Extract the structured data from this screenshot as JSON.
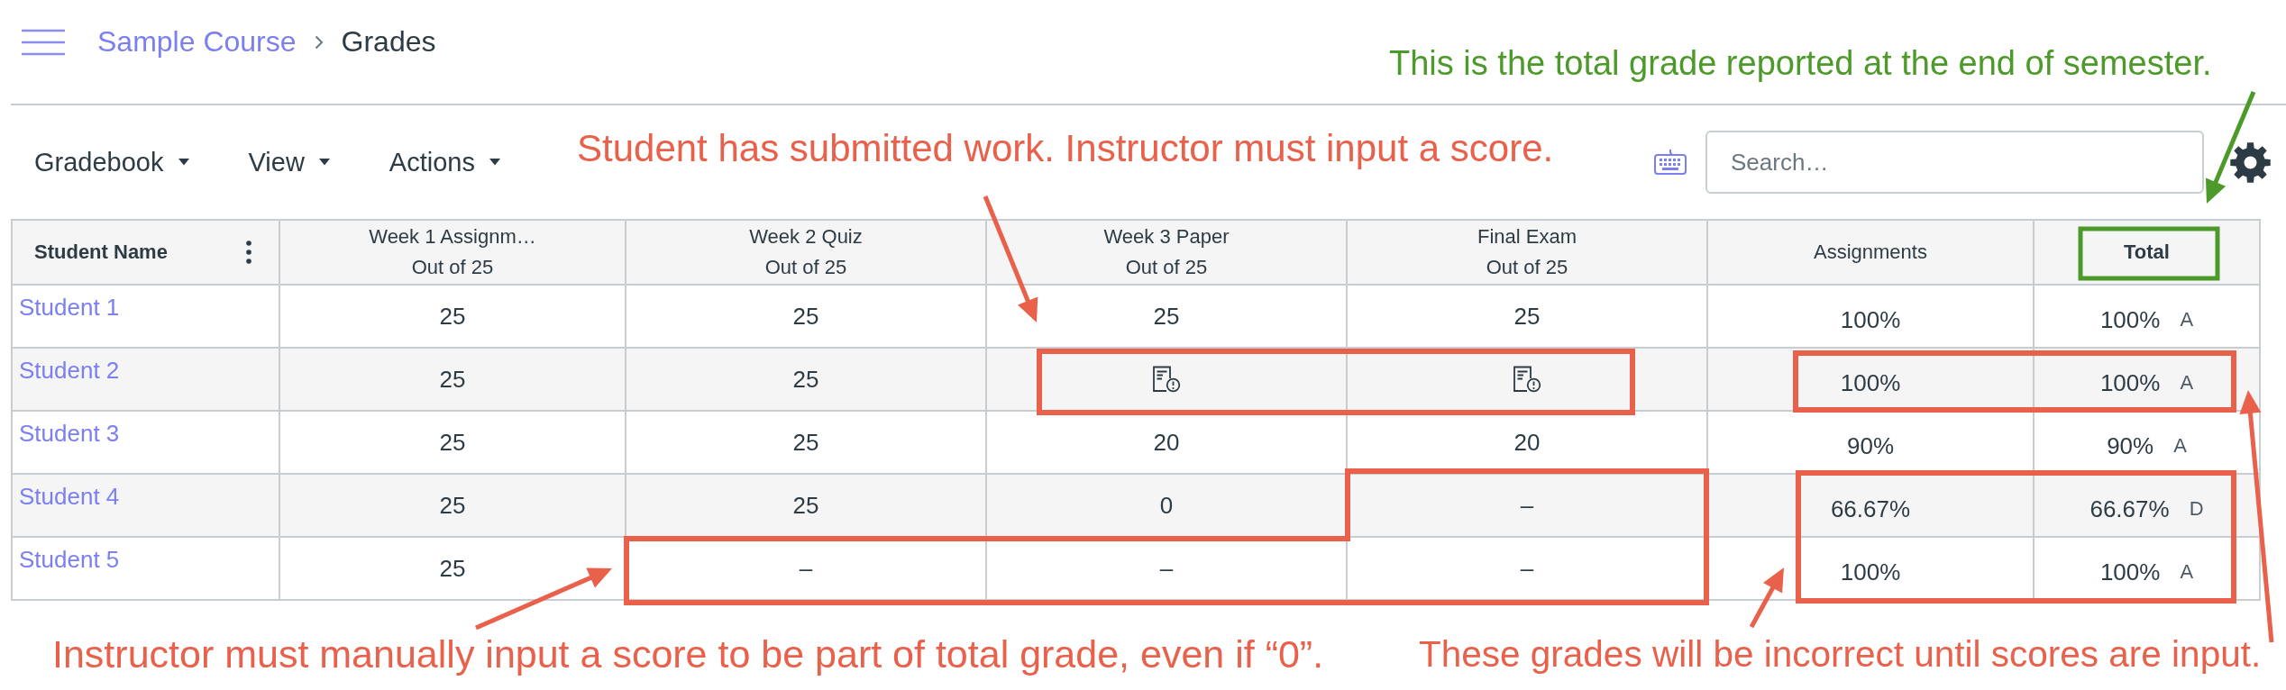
{
  "topbar": {
    "breadcrumb": [
      {
        "label": "Sample Course",
        "kind": "link"
      },
      {
        "label": "Grades",
        "kind": "current"
      }
    ]
  },
  "toolbar": {
    "menus": [
      {
        "label": "Gradebook"
      },
      {
        "label": "View"
      },
      {
        "label": "Actions"
      }
    ],
    "search": {
      "placeholder": "Search…"
    }
  },
  "table": {
    "columns": [
      {
        "title": "Student Name",
        "kind": "name"
      },
      {
        "title": "Week 1 Assignm…",
        "subtitle": "Out of 25",
        "kind": "assignment"
      },
      {
        "title": "Week 2 Quiz",
        "subtitle": "Out of 25",
        "kind": "assignment"
      },
      {
        "title": "Week 3 Paper",
        "subtitle": "Out of 25",
        "kind": "assignment"
      },
      {
        "title": "Final Exam",
        "subtitle": "Out of 25",
        "kind": "assignment"
      },
      {
        "title": "Assignments",
        "kind": "group"
      },
      {
        "title": "Total",
        "kind": "total"
      }
    ],
    "rows": [
      {
        "cells": [
          {
            "kind": "student",
            "text": "Student 1"
          },
          {
            "kind": "score",
            "text": "25"
          },
          {
            "kind": "score",
            "text": "25"
          },
          {
            "kind": "score",
            "text": "25"
          },
          {
            "kind": "score",
            "text": "25"
          },
          {
            "kind": "percent",
            "text": "100%"
          },
          {
            "kind": "grade",
            "text": "100%",
            "letter": "A"
          }
        ]
      },
      {
        "cells": [
          {
            "kind": "student",
            "text": "Student 2"
          },
          {
            "kind": "score",
            "text": "25"
          },
          {
            "kind": "score",
            "text": "25"
          },
          {
            "kind": "submitted"
          },
          {
            "kind": "submitted"
          },
          {
            "kind": "percent",
            "text": "100%"
          },
          {
            "kind": "grade",
            "text": "100%",
            "letter": "A"
          }
        ]
      },
      {
        "cells": [
          {
            "kind": "student",
            "text": "Student 3"
          },
          {
            "kind": "score",
            "text": "25"
          },
          {
            "kind": "score",
            "text": "25"
          },
          {
            "kind": "score",
            "text": "20"
          },
          {
            "kind": "score",
            "text": "20"
          },
          {
            "kind": "percent",
            "text": "90%"
          },
          {
            "kind": "grade",
            "text": "90%",
            "letter": "A"
          }
        ]
      },
      {
        "cells": [
          {
            "kind": "student",
            "text": "Student 4"
          },
          {
            "kind": "score",
            "text": "25"
          },
          {
            "kind": "score",
            "text": "25"
          },
          {
            "kind": "score",
            "text": "0"
          },
          {
            "kind": "score",
            "text": "–"
          },
          {
            "kind": "percent",
            "text": "66.67%"
          },
          {
            "kind": "grade",
            "text": "66.67%",
            "letter": "D"
          }
        ]
      },
      {
        "cells": [
          {
            "kind": "student",
            "text": "Student 5"
          },
          {
            "kind": "score",
            "text": "25"
          },
          {
            "kind": "score",
            "text": "–"
          },
          {
            "kind": "score",
            "text": "–"
          },
          {
            "kind": "score",
            "text": "–"
          },
          {
            "kind": "percent",
            "text": "100%"
          },
          {
            "kind": "grade",
            "text": "100%",
            "letter": "A"
          }
        ]
      }
    ]
  },
  "annotations": [
    {
      "text": "This is the total grade reported at the end of semester.",
      "color": "#4c9a2a"
    },
    {
      "text": "Student has submitted work. Instructor must input a score.",
      "color": "#e9604b"
    },
    {
      "text": "Instructor must manually input a score to be part of total grade, even if “0”.",
      "color": "#e9604b"
    },
    {
      "text": "These grades will be incorrect until scores are input.",
      "color": "#e9604b"
    }
  ]
}
